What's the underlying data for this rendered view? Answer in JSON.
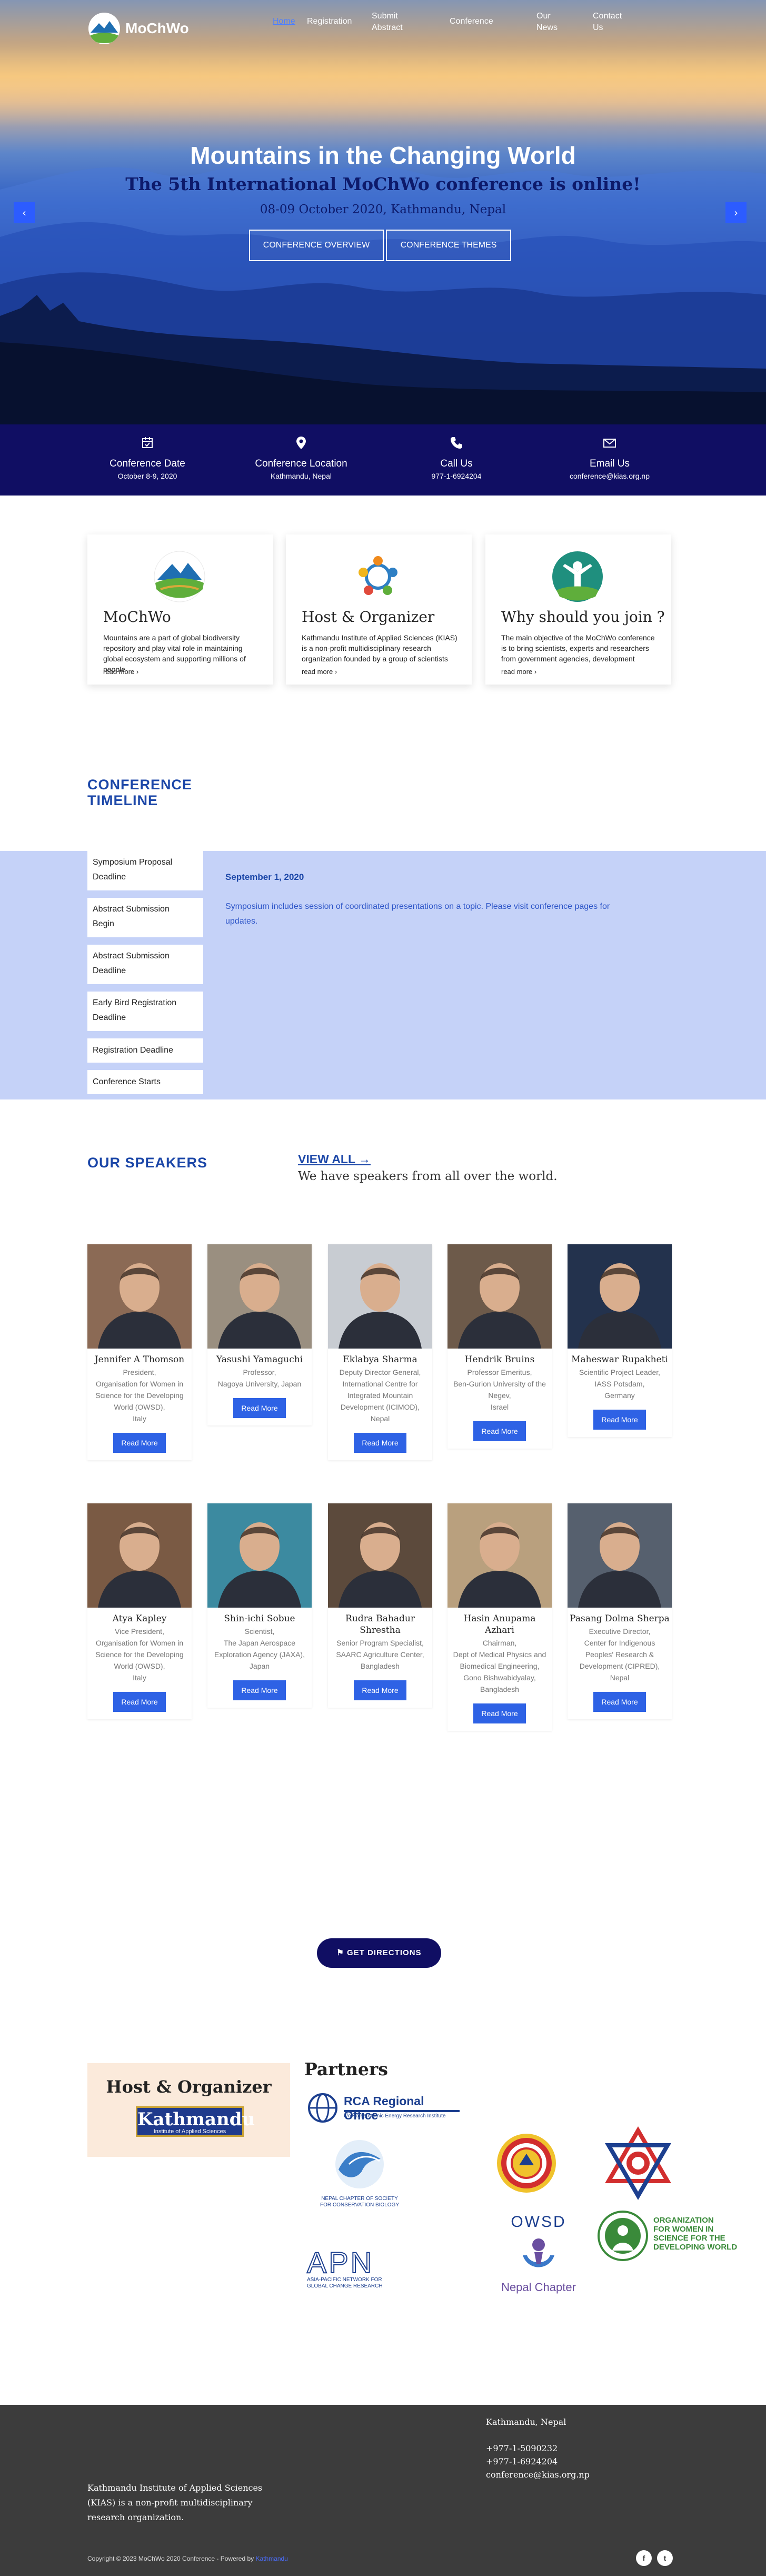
{
  "nav": {
    "logo_text": "MoChWo",
    "items": [
      {
        "label": "Home",
        "active": true
      },
      {
        "label": "Registration"
      },
      {
        "label": "Submit\nAbstract"
      },
      {
        "label": "Conference"
      },
      {
        "label": "Our\nNews"
      },
      {
        "label": "Contact\nUs"
      }
    ]
  },
  "hero": {
    "title": "Mountains in the Changing World",
    "subtitle": "The 5th International MoChWo conference is online!",
    "date_place": "08-09 October 2020, Kathmandu, Nepal",
    "btn_overview": "CONFERENCE OVERVIEW",
    "btn_themes": "CONFERENCE THEMES",
    "prev": "‹",
    "next": "›"
  },
  "info": [
    {
      "icon": "calendar-icon",
      "label": "Conference Date",
      "value": "October 8-9, 2020"
    },
    {
      "icon": "map-pin-icon",
      "label": "Conference Location",
      "value": "Kathmandu, Nepal"
    },
    {
      "icon": "phone-icon",
      "label": "Call Us",
      "value": "977-1-6924204"
    },
    {
      "icon": "envelope-icon",
      "label": "Email Us",
      "value": "conference@kias.org.np"
    }
  ],
  "cards": [
    {
      "title": "MoChWo",
      "text": "Mountains are a part of global biodiversity repository and play vital role in maintaining global ecosystem and supporting millions of people",
      "more": "read more ›"
    },
    {
      "title": "Host & Organizer",
      "text": "Kathmandu Institute of Applied Sciences (KIAS) is a non-profit multidisciplinary research organization founded by a group of scientists",
      "more": "read more ›"
    },
    {
      "title": "Why should you join ?",
      "text": "The main objective of the MoChWo conference is to bring scientists, experts and researchers from government agencies, development",
      "more": "read more ›"
    }
  ],
  "timeline": {
    "title_line1": "CONFERENCE",
    "title_line2": "TIMELINE",
    "items": [
      "Symposium Proposal\nDeadline",
      "Abstract Submission\nBegin",
      "Abstract Submission\nDeadline",
      "Early Bird Registration\nDeadline",
      "Registration Deadline",
      "Conference Starts"
    ],
    "active_date": "September 1, 2020",
    "active_text": "Symposium includes session of coordinated presentations on a topic. Please visit conference pages for updates."
  },
  "speakers_section": {
    "title": "OUR SPEAKERS",
    "view_all": "VIEW ALL →",
    "intro": "We have speakers from all over the world.",
    "read_more": "Read More"
  },
  "speakers": [
    {
      "name": "Jennifer A Thomson",
      "desc": "President,\nOrganisation for Women in Science for the Developing World (OWSD),\nItaly",
      "bg": "#8b6a55"
    },
    {
      "name": "Yasushi Yamaguchi",
      "desc": "Professor,\nNagoya University, Japan",
      "bg": "#9a8f80"
    },
    {
      "name": "Eklabya Sharma",
      "desc": "Deputy Director General,\nInternational Centre for Integrated Mountain Development (ICIMOD),\nNepal",
      "bg": "#c8ccd2"
    },
    {
      "name": "Hendrik Bruins",
      "desc": "Professor Emeritus,\nBen-Gurion University of the Negev,\nIsrael",
      "bg": "#6d5a4a"
    },
    {
      "name": "Maheswar Rupakheti",
      "desc": "Scientific Project Leader,\nIASS Potsdam,\nGermany",
      "bg": "#23324d"
    },
    {
      "name": "Atya Kapley",
      "desc": "Vice President,\nOrganisation for Women in Science for the Developing World (OWSD),\nItaly",
      "bg": "#7a5a44"
    },
    {
      "name": "Shin-ichi Sobue",
      "desc": "Scientist,\nThe Japan Aerospace Exploration Agency (JAXA),\nJapan",
      "bg": "#3c8aa0"
    },
    {
      "name": "Rudra Bahadur\nShrestha",
      "desc": "Senior Program Specialist,\nSAARC Agriculture Center,\nBangladesh",
      "bg": "#5c4a3c"
    },
    {
      "name": "Hasin Anupama Azhari",
      "desc": "Chairman,\nDept of Medical Physics and Biomedical Engineering,\nGono Bishwabidyalay,\nBangladesh",
      "bg": "#b9a07e"
    },
    {
      "name": "Pasang Dolma Sherpa",
      "desc": "Executive Director,\nCenter for Indigenous Peoples' Research & Development (CIPRED),\nNepal",
      "bg": "#56606e"
    }
  ],
  "directions": {
    "label": "GET DIRECTIONS",
    "icon": "map-icon"
  },
  "partners": {
    "host_title": "Host & Organizer",
    "kias_logo": "Kathmandu",
    "kias_sub": "Institute of Applied Sciences",
    "title": "Partners",
    "rca": "RCA Regional Office",
    "rca_sub": "c/o Korea Atomic Energy Research Institute",
    "ncscb": "NEPAL CHAPTER OF SOCIETY\nFOR CONSERVATION BIOLOGY",
    "apn": "APN",
    "apn_sub": "ASIA-PACIFIC NETWORK FOR\nGLOBAL CHANGE RESEARCH",
    "owsd_chapter": "OWSD",
    "owsd_chapter_sub": "Nepal Chapter",
    "owsd": "ORGANIZATION\nFOR WOMEN IN\nSCIENCE FOR THE\nDEVELOPING WORLD"
  },
  "footer": {
    "city": "Kathmandu, Nepal",
    "phone1": "+977-1-5090232",
    "phone2": "+977-1-6924204",
    "email": "conference@kias.org.np",
    "about": "Kathmandu Institute of Applied Sciences (KIAS) is a non-profit multidisciplinary research organization.",
    "copyright": "Copyright © 2023 MoChWo 2020 Conference - Powered by",
    "powered": "Kathmandu",
    "social": [
      "f",
      "t"
    ]
  }
}
